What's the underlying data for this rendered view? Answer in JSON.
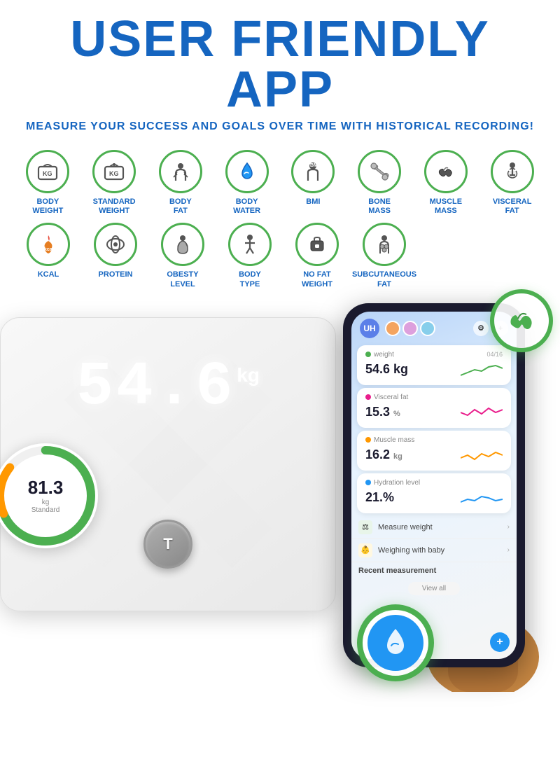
{
  "header": {
    "main_title": "USER FRIENDLY APP",
    "subtitle": "MEASURE YOUR SUCCESS AND GOALS OVER TIME WITH HISTORICAL RECORDING!"
  },
  "icons_row1": [
    {
      "label": "BODY\nWEIGHT",
      "icon": "weight-kg"
    },
    {
      "label": "STANDARD\nWEIGHT",
      "icon": "weight-kg-2"
    },
    {
      "label": "BODY\nFAT",
      "icon": "body-fat"
    },
    {
      "label": "BODY\nWATER",
      "icon": "water-drop"
    },
    {
      "label": "BMI",
      "icon": "bmi"
    },
    {
      "label": "BONE\nMASS",
      "icon": "bone"
    },
    {
      "label": "MUSCLE\nMASS",
      "icon": "muscle"
    },
    {
      "label": "VISCERAL\nFAT",
      "icon": "visceral"
    }
  ],
  "icons_row2": [
    {
      "label": "KCAL",
      "icon": "kcal"
    },
    {
      "label": "PROTEIN",
      "icon": "protein"
    },
    {
      "label": "OBESTY\nLEVEL",
      "icon": "obesty"
    },
    {
      "label": "BODY\nTYPE",
      "icon": "body-type"
    },
    {
      "label": "NO FAT\nWEIGHT",
      "icon": "no-fat"
    },
    {
      "label": "SUBCUTANEOUS\nFAT",
      "icon": "subcutaneous"
    }
  ],
  "scale": {
    "display_value": "54.6",
    "unit": "kg",
    "button_label": "T"
  },
  "phone_app": {
    "app_initials": "UH",
    "weight_label": "weight",
    "weight_value": "54.6 kg",
    "weight_trend": "04/16",
    "visceral_label": "Visceral fat",
    "visceral_value": "15.3",
    "visceral_unit": "%",
    "muscle_label": "Muscle mass",
    "muscle_value": "16.2",
    "muscle_unit": "kg",
    "hydration_label": "Hydration level",
    "hydration_value": "21.%",
    "measure_weight": "Measure weight",
    "weighing_baby": "Weighing with baby",
    "recent_measurement": "Recent measurement",
    "view_all": "View all",
    "add_btn": "+"
  },
  "gauge": {
    "value": "81.3",
    "unit": "kg",
    "label": "Standard"
  },
  "colors": {
    "primary_blue": "#1565C0",
    "green": "#4CAF50",
    "accent_blue": "#2196F3"
  }
}
